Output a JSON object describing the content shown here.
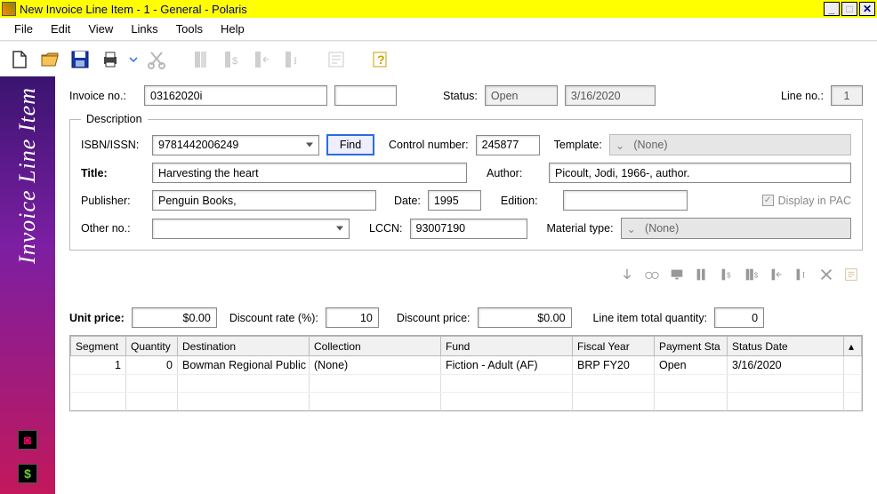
{
  "window": {
    "title": "New Invoice Line Item - 1 - General - Polaris"
  },
  "menu": {
    "file": "File",
    "edit": "Edit",
    "view": "View",
    "links": "Links",
    "tools": "Tools",
    "help": "Help"
  },
  "toolbar_icons": {
    "new": "new-file-icon",
    "open": "open-folder-icon",
    "save": "save-disk-icon",
    "print": "print-icon",
    "cut": "cut-icon",
    "book1": "book-icon",
    "book-money": "book-dollar-icon",
    "book-left": "book-left-icon",
    "book-i": "book-i-icon",
    "form": "form-icon",
    "help": "help-icon"
  },
  "sidebar": {
    "title": "Invoice Line Item"
  },
  "header": {
    "invoice_no_label": "Invoice no.:",
    "invoice_no": "03162020i",
    "status_label": "Status:",
    "status": "Open",
    "date": "3/16/2020",
    "line_no_label": "Line no.:",
    "line_no": "1"
  },
  "desc": {
    "legend": "Description",
    "isbn_label": "ISBN/ISSN:",
    "isbn": "9781442006249",
    "find": "Find",
    "control_label": "Control number:",
    "control": "245877",
    "template_label": "Template:",
    "template_value": "(None)",
    "title_label": "Title:",
    "title": "Harvesting the heart",
    "author_label": "Author:",
    "author": "Picoult, Jodi, 1966-, author.",
    "publisher_label": "Publisher:",
    "publisher": "Penguin Books,",
    "date_label": "Date:",
    "date": "1995",
    "edition_label": "Edition:",
    "edition": "",
    "pac_label": "Display in PAC",
    "other_label": "Other no.:",
    "other": "",
    "lccn_label": "LCCN:",
    "lccn": "93007190",
    "mtype_label": "Material type:",
    "mtype": "(None)"
  },
  "pricing": {
    "unit_label": "Unit price:",
    "unit": "$0.00",
    "discrate_label": "Discount rate (%):",
    "discrate": "10",
    "discprice_label": "Discount price:",
    "discprice": "$0.00",
    "lineqty_label": "Line item total quantity:",
    "lineqty": "0"
  },
  "grid": {
    "cols": {
      "segment": "Segment",
      "qty": "Quantity",
      "dest": "Destination",
      "coll": "Collection",
      "fund": "Fund",
      "fy": "Fiscal Year",
      "paystat": "Payment Sta",
      "statdate": "Status Date"
    },
    "rows": [
      {
        "segment": "1",
        "qty": "0",
        "dest": "Bowman Regional Public",
        "coll": "(None)",
        "fund": "Fiction - Adult (AF)",
        "fy": "BRP FY20",
        "paystat": "Open",
        "statdate": "3/16/2020"
      }
    ]
  }
}
